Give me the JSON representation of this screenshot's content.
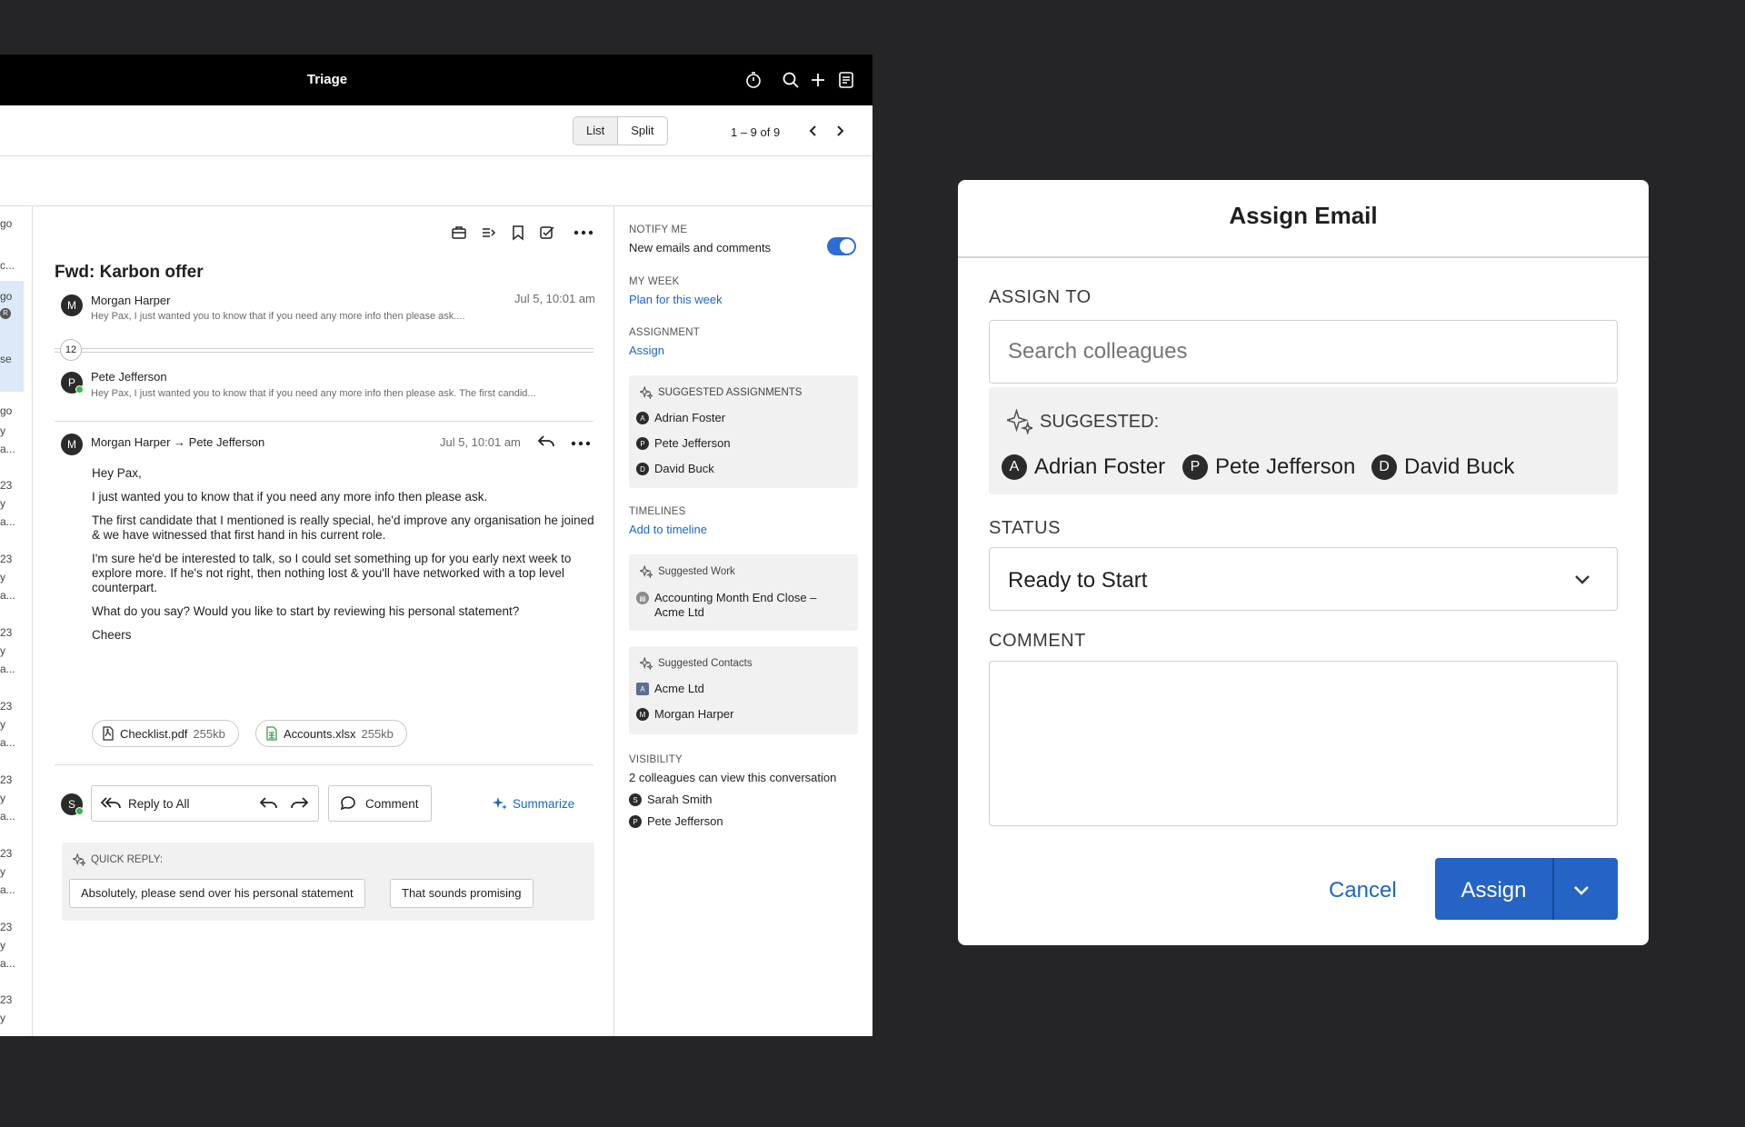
{
  "app": {
    "title": "Triage",
    "view_toggle": {
      "list": "List",
      "split": "Split"
    },
    "pager": "1 – 9 of 9"
  },
  "list_strip": [
    "go",
    "c...",
    "go",
    "R",
    "se",
    "go",
    "y",
    "a...",
    "23",
    "y",
    "a...",
    "23",
    "y",
    "a...",
    "23",
    "y",
    "a...",
    "23",
    "y",
    "a...",
    "23",
    "y",
    "a...",
    "23",
    "y",
    "a...",
    "23",
    "y",
    "a...",
    "23",
    "y"
  ],
  "email": {
    "subject": "Fwd: Karbon offer",
    "thread": [
      {
        "initial": "M",
        "sender": "Morgan Harper",
        "date": "Jul 5, 10:01 am",
        "snippet": "Hey Pax, I just wanted you to know that if you need any more info then please ask...."
      },
      {
        "initial": "P",
        "sender": "Pete Jefferson",
        "snippet": "Hey Pax, I just wanted you to know that if you need any more info then please ask. The first candid..."
      }
    ],
    "collapsed_count": "12",
    "open_message": {
      "initial": "M",
      "header": "Morgan Harper → Pete Jefferson",
      "date": "Jul 5, 10:01 am",
      "paragraphs": [
        "Hey Pax,",
        "I just wanted you to know that if you need any more info then please ask.",
        "The first candidate that I mentioned is really special, he'd improve any organisation he joined & we have witnessed that first hand in his current role.",
        "I'm sure he'd be interested to talk, so I could set something up for you early next week to explore more. If he's not right, then nothing lost & you'll have networked with a top level counterpart.",
        "What do you say? Would you like to start by reviewing his personal statement?",
        "Cheers"
      ]
    },
    "attachments": [
      {
        "name": "Checklist.pdf",
        "size": "255kb"
      },
      {
        "name": "Accounts.xlsx",
        "size": "255kb"
      }
    ],
    "composer": {
      "avatar": "S",
      "reply_all": "Reply to All",
      "comment": "Comment",
      "summarize": "Summarize"
    },
    "quick_reply": {
      "label": "QUICK REPLY:",
      "options": [
        "Absolutely, please send over his personal statement",
        "That sounds promising"
      ]
    }
  },
  "panel": {
    "notify_label": "NOTIFY ME",
    "notify_text": "New emails and comments",
    "notify_on": true,
    "my_week_label": "MY WEEK",
    "my_week_link": "Plan for this week",
    "assignment_label": "ASSIGNMENT",
    "assignment_link": "Assign",
    "suggested_assignments": {
      "label": "SUGGESTED ASSIGNMENTS",
      "people": [
        {
          "initial": "A",
          "name": "Adrian Foster"
        },
        {
          "initial": "P",
          "name": "Pete Jefferson"
        },
        {
          "initial": "D",
          "name": "David Buck"
        }
      ]
    },
    "timelines_label": "TIMELINES",
    "timelines_link": "Add to timeline",
    "suggested_work": {
      "label": "Suggested Work",
      "item_line1": "Accounting  Month End Close –",
      "item_line2": "Acme Ltd"
    },
    "suggested_contacts": {
      "label": "Suggested Contacts",
      "items": [
        {
          "initial": "A",
          "name": "Acme Ltd"
        },
        {
          "initial": "M",
          "name": "Morgan Harper"
        }
      ]
    },
    "visibility_label": "VISIBILITY",
    "visibility_text": "2 colleagues can view this conversation",
    "visible_to": [
      {
        "initial": "S",
        "name": "Sarah Smith"
      },
      {
        "initial": "P",
        "name": "Pete Jefferson"
      }
    ]
  },
  "modal": {
    "title": "Assign Email",
    "assign_to_label": "ASSIGN TO",
    "search_placeholder": "Search colleagues",
    "suggested_label": "SUGGESTED:",
    "suggested": [
      {
        "initial": "A",
        "name": "Adrian Foster"
      },
      {
        "initial": "P",
        "name": "Pete Jefferson"
      },
      {
        "initial": "D",
        "name": "David Buck"
      }
    ],
    "status_label": "STATUS",
    "status_value": "Ready to Start",
    "comment_label": "COMMENT",
    "comment_value": "",
    "cancel": "Cancel",
    "assign": "Assign"
  },
  "colors": {
    "accent": "#2563c4",
    "link": "#1a66c9",
    "topbar": "#000000",
    "backdrop": "#252527",
    "online": "#3cb54a"
  }
}
